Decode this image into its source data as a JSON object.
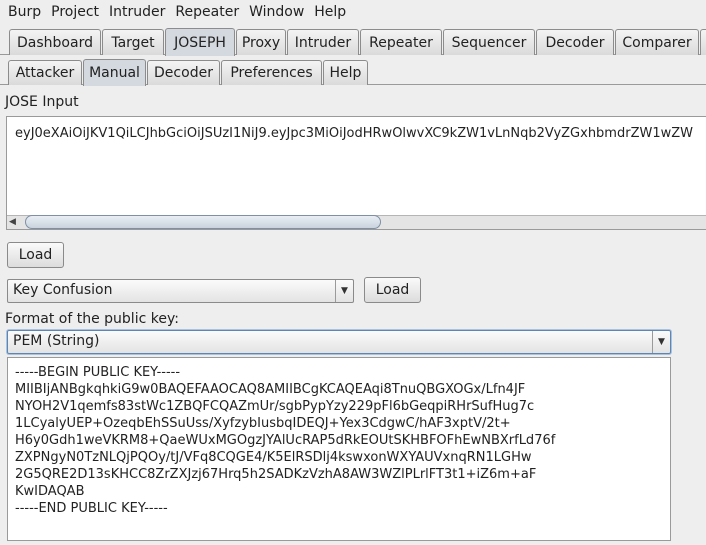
{
  "menubar": [
    "Burp",
    "Project",
    "Intruder",
    "Repeater",
    "Window",
    "Help"
  ],
  "main_tabs": [
    {
      "label": "Dashboard",
      "selected": false
    },
    {
      "label": "Target",
      "selected": false
    },
    {
      "label": "JOSEPH",
      "selected": true
    },
    {
      "label": "Proxy",
      "selected": false
    },
    {
      "label": "Intruder",
      "selected": false
    },
    {
      "label": "Repeater",
      "selected": false
    },
    {
      "label": "Sequencer",
      "selected": false
    },
    {
      "label": "Decoder",
      "selected": false
    },
    {
      "label": "Comparer",
      "selected": false
    }
  ],
  "sub_tabs": [
    {
      "label": "Attacker",
      "selected": false
    },
    {
      "label": "Manual",
      "selected": true
    },
    {
      "label": "Decoder",
      "selected": false
    },
    {
      "label": "Preferences",
      "selected": false
    },
    {
      "label": "Help",
      "selected": false
    }
  ],
  "jose": {
    "label": "JOSE Input",
    "value": "eyJ0eXAiOiJKV1QiLCJhbGciOiJSUzI1NiJ9.eyJpc3MiOiJodHRwOlwvXC9kZW1vLnNqb2VyZGxhbmdrZW1wZW",
    "load_label": "Load"
  },
  "attack": {
    "selected": "Key Confusion",
    "load_label": "Load"
  },
  "public_key": {
    "format_label": "Format of the public key:",
    "format_selected": "PEM (String)",
    "lines": [
      "-----BEGIN PUBLIC KEY-----",
      "MIIBIjANBgkqhkiG9w0BAQEFAAOCAQ8AMIIBCgKCAQEAqi8TnuQBGXOGx/Lfn4JF",
      "NYOH2V1qemfs83stWc1ZBQFCQAZmUr/sgbPypYzy229pFl6bGeqpiRHrSufHug7c",
      "1LCyalyUEP+OzeqbEhSSuUss/XyfzybIusbqIDEQJ+Yex3CdgwC/hAF3xptV/2t+",
      "H6y0Gdh1weVKRM8+QaeWUxMGOgzJYAlUcRAP5dRkEOUtSKHBFOFhEwNBXrfLd76f",
      "ZXPNgyN0TzNLQjPQOy/tJ/VFq8CQGE4/K5ElRSDlj4kswxonWXYAUVxnqRN1LGHw",
      "2G5QRE2D13sKHCC8ZrZXJzj67Hrq5h2SADKzVzhA8AW3WZlPLrlFT3t1+iZ6m+aF",
      "KwIDAQAB",
      "-----END PUBLIC KEY-----"
    ]
  }
}
